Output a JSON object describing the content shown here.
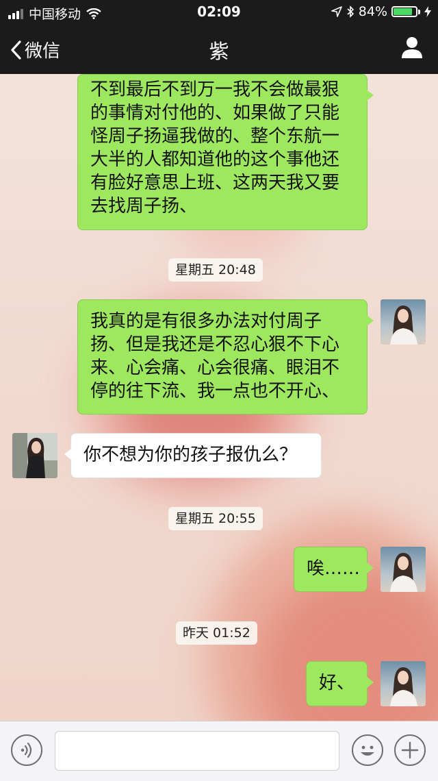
{
  "status_bar": {
    "carrier": "中国移动",
    "time": "02:09",
    "battery": "84%",
    "battery_level": 0.84
  },
  "nav": {
    "back_label": "微信",
    "title": "紫"
  },
  "messages": [
    {
      "id": "m1",
      "type": "text",
      "direction": "out",
      "lines": [
        "不到最后不到万一我不会做最狠",
        "的事情对付他的、如果做了只能",
        "怪周子扬逼我做的、整个东航一",
        "大半的人都知道他的这个事他还",
        "有脸好意思上班、这两天我又要",
        "去找周子扬、"
      ]
    },
    {
      "id": "t1",
      "type": "time",
      "text": "星期五 20:48"
    },
    {
      "id": "m2",
      "type": "text",
      "direction": "out",
      "lines": [
        "我真的是有很多办法对付周子",
        "扬、但是我还是不忍心狠不下心",
        "来、心会痛、心会很痛、眼泪不",
        "停的往下流、我一点也不开心、"
      ]
    },
    {
      "id": "m3",
      "type": "text",
      "direction": "in",
      "lines": [
        "你不想为你的孩子报仇么？"
      ]
    },
    {
      "id": "t2",
      "type": "time",
      "text": "星期五 20:55"
    },
    {
      "id": "m4",
      "type": "text",
      "direction": "out",
      "lines": [
        "唉……"
      ]
    },
    {
      "id": "t3",
      "type": "time",
      "text": "昨天 01:52"
    },
    {
      "id": "m5",
      "type": "text",
      "direction": "out",
      "lines": [
        "好、"
      ]
    }
  ],
  "input_bar": {
    "placeholder": "",
    "voice_icon": "voice-icon",
    "emoji_icon": "emoji-icon",
    "plus_icon": "plus-icon"
  },
  "colors": {
    "bar_bg": "#1b1b1b",
    "outgoing_bubble": "#9ee85f",
    "incoming_bubble": "#ffffff",
    "battery_fill": "#4cd964"
  }
}
